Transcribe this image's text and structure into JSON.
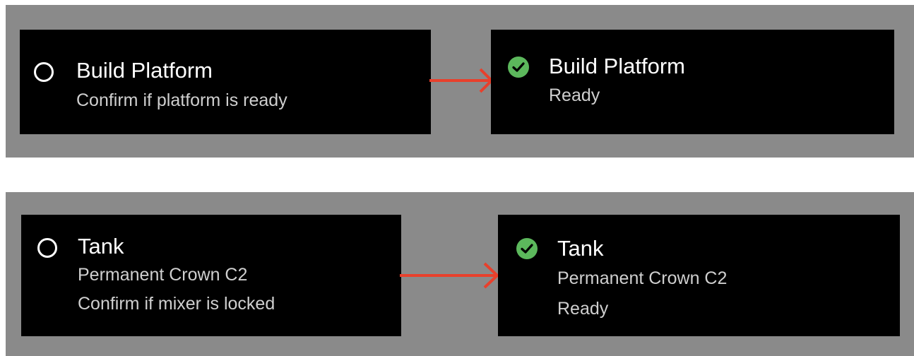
{
  "colors": {
    "background_panel": "#8a8a8a",
    "card": "#000000",
    "check": "#5cb85c",
    "arrow": "#e8402c"
  },
  "rows": [
    {
      "before": {
        "icon": "empty-circle-icon",
        "title": "Build Platform",
        "lines": [
          "Confirm if platform is ready"
        ]
      },
      "after": {
        "icon": "green-check-icon",
        "title": "Build Platform",
        "lines": [
          "Ready"
        ]
      }
    },
    {
      "before": {
        "icon": "empty-circle-icon",
        "title": "Tank",
        "lines": [
          "Permanent Crown C2",
          "Confirm if mixer is locked"
        ]
      },
      "after": {
        "icon": "green-check-icon",
        "title": "Tank",
        "lines": [
          "Permanent Crown C2",
          "Ready"
        ]
      }
    }
  ]
}
